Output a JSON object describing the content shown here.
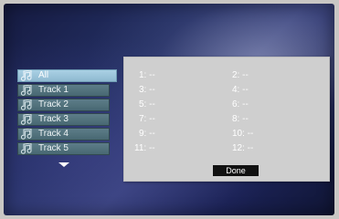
{
  "playlist": {
    "items": [
      {
        "label": "All",
        "selected": true
      },
      {
        "label": "Track 1",
        "selected": false
      },
      {
        "label": "Track 2",
        "selected": false
      },
      {
        "label": "Track 3",
        "selected": false
      },
      {
        "label": "Track 4",
        "selected": false
      },
      {
        "label": "Track 5",
        "selected": false
      }
    ],
    "scroll_icon": "down-arrow-icon",
    "item_icon": "music-note-icon"
  },
  "program_panel": {
    "slots": [
      "1: --",
      "2: --",
      "3: --",
      "4: --",
      "5: --",
      "6: --",
      "7: --",
      "8: --",
      "9: --",
      "10: --",
      "11: --",
      "12: --"
    ],
    "done_label": "Done"
  },
  "colors": {
    "selected_item": "#9fc8de",
    "track_item": "#547680",
    "panel_bg": "#cfcfcf",
    "button_bg": "#111111"
  }
}
